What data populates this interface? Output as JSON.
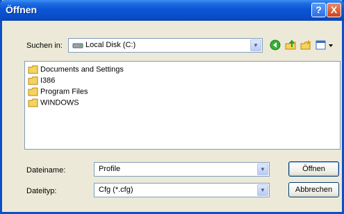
{
  "window": {
    "title": "Öffnen",
    "help_icon": "?",
    "close_icon": "X"
  },
  "lookin": {
    "label": "Suchen in:",
    "value": "Local Disk (C:)",
    "drive_icon": "drive-icon"
  },
  "toolbar": {
    "back_icon": "back-icon",
    "up_icon": "up-folder-icon",
    "new_folder_icon": "new-folder-icon",
    "views_icon": "views-menu-icon"
  },
  "files": [
    {
      "name": "Documents and Settings"
    },
    {
      "name": "I386"
    },
    {
      "name": "Program Files"
    },
    {
      "name": "WINDOWS"
    }
  ],
  "filename": {
    "label": "Dateiname:",
    "value": "Profile"
  },
  "filetype": {
    "label": "Dateityp:",
    "value": "Cfg (*.cfg)"
  },
  "buttons": {
    "open": "Öffnen",
    "cancel": "Abbrechen"
  },
  "colors": {
    "titlebar": "#0a4ec8",
    "face": "#ece9d8",
    "folder": "#f4d35e"
  }
}
